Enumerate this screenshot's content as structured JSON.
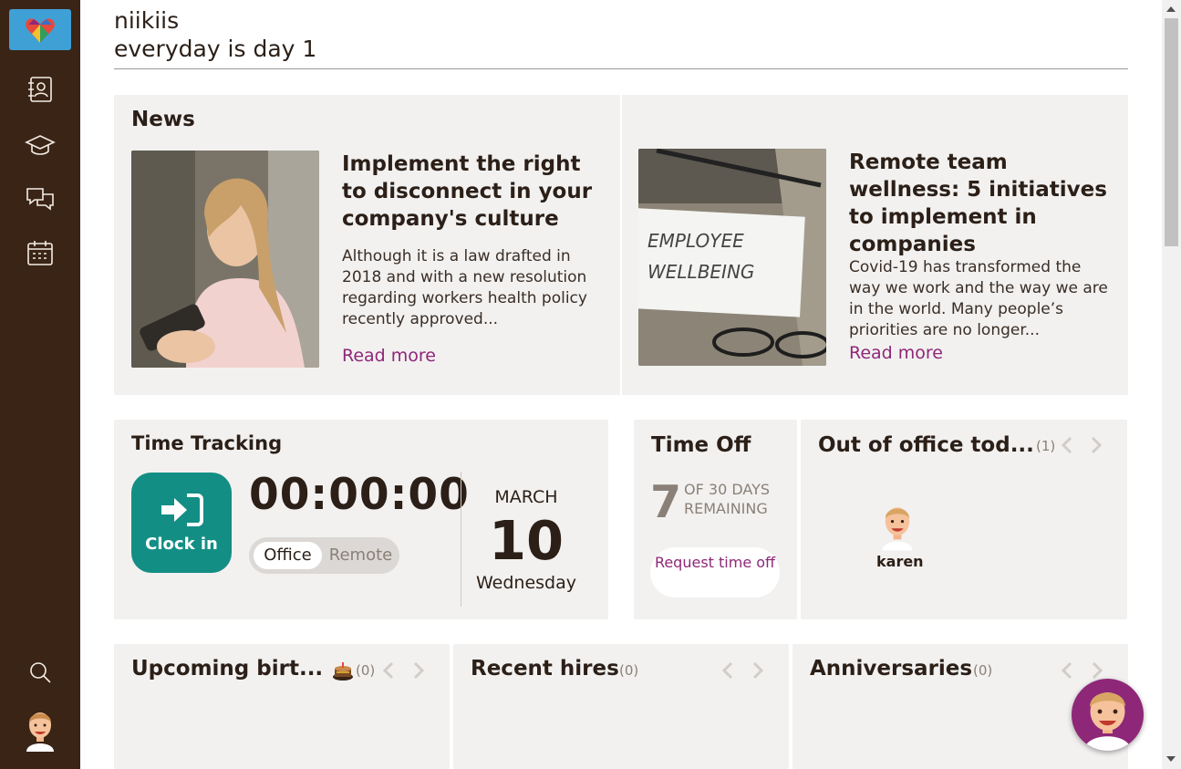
{
  "header": {
    "name": "niikiis",
    "motto": "everyday is day 1"
  },
  "sidebar": {
    "items": [
      {
        "name": "directory-icon"
      },
      {
        "name": "graduation-cap-icon"
      },
      {
        "name": "chat-icon"
      },
      {
        "name": "calendar-icon"
      },
      {
        "name": "search-icon"
      }
    ]
  },
  "news": {
    "title": "News",
    "articles": [
      {
        "headline": "Implement the right to disconnect in your company's culture",
        "excerpt": "Although it is a law drafted in 2018 and with a new resolution regarding workers health policy recently approved...",
        "read_more": "Read more"
      },
      {
        "headline": "Remote team wellness: 5 initiatives to implement in companies",
        "excerpt": "Covid-19 has transformed the way we work and the way we are in the world. Many people’s priorities are no longer...",
        "read_more": "Read more",
        "image_text_1": "EMPLOYEE",
        "image_text_2": "WELLBEING"
      }
    ]
  },
  "time_tracking": {
    "title": "Time Tracking",
    "clock_label": "Clock in",
    "timer": "00:00:00",
    "toggle_on": "Office",
    "toggle_off": "Remote",
    "month": "MARCH",
    "day": "10",
    "weekday": "Wednesday"
  },
  "time_off": {
    "title": "Time Off",
    "days": "7",
    "days_text": "OF 30 DAYS REMAINING",
    "request_label": "Request time off"
  },
  "out_of_office": {
    "title": "Out of office tod...",
    "count": "(1)",
    "people": [
      {
        "name": "karen"
      }
    ]
  },
  "birthdays": {
    "title": "Upcoming birt...",
    "count": "(0)"
  },
  "recent_hires": {
    "title": "Recent hires",
    "count": "(0)"
  },
  "anniversaries": {
    "title": "Anniversaries",
    "count": "(0)"
  },
  "colors": {
    "sidebar": "#3a2415",
    "accent": "#8e2778",
    "teal": "#138e84",
    "card": "#f2f1f0"
  }
}
